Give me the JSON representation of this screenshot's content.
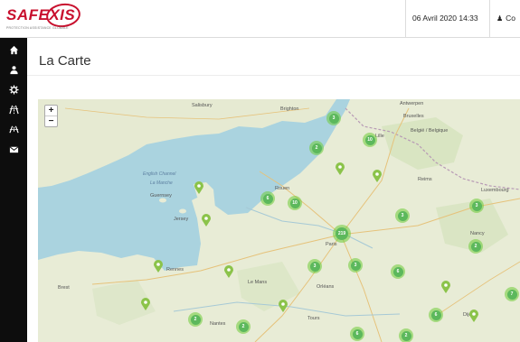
{
  "header": {
    "logo_text": "SAFEXIS",
    "logo_tagline": "PROTECTION ASSISTANCE GLOBALE",
    "datetime": "06 Avril 2020 14:33",
    "user_label": "Co"
  },
  "sidebar": {
    "items": [
      {
        "icon": "home-icon"
      },
      {
        "icon": "user-icon"
      },
      {
        "icon": "settings-icon"
      },
      {
        "icon": "road-icon"
      },
      {
        "icon": "truck-icon"
      },
      {
        "icon": "envelope-icon"
      }
    ]
  },
  "page": {
    "title": "La Carte"
  },
  "map": {
    "zoom_in": "+",
    "zoom_out": "−",
    "places": {
      "salisbury": "Salisbury",
      "brighton": "Brighton",
      "antwerpen": "Antwerpen",
      "bruxelles": "Bruxelles",
      "belgique": "België / Belgique",
      "lille": "Lille",
      "rouen": "Rouen",
      "paris": "Paris",
      "rennes": "Rennes",
      "le_mans": "Le Mans",
      "orleans": "Orléans",
      "nancy": "Nancy",
      "luxembourg": "Luxembourg",
      "jersey": "Jersey",
      "guernsey": "Guernsey",
      "english_channel": "English Channel",
      "manche": "La Manche",
      "brest": "Brest",
      "nantes": "Nantes",
      "tours": "Tours",
      "dijon": "Dijon",
      "reims": "Reims"
    },
    "clusters": [
      "3",
      "2",
      "10",
      "6",
      "10",
      "3",
      "219",
      "3",
      "3",
      "6",
      "3",
      "2",
      "7",
      "2",
      "2",
      "6",
      "6",
      "2"
    ]
  },
  "colors": {
    "brand": "#c8102e",
    "sidebar": "#0d0d0d",
    "sea": "#aad3df",
    "land": "#e8ecd8",
    "cluster": "#5cb85c",
    "pin": "#8bc34a"
  }
}
